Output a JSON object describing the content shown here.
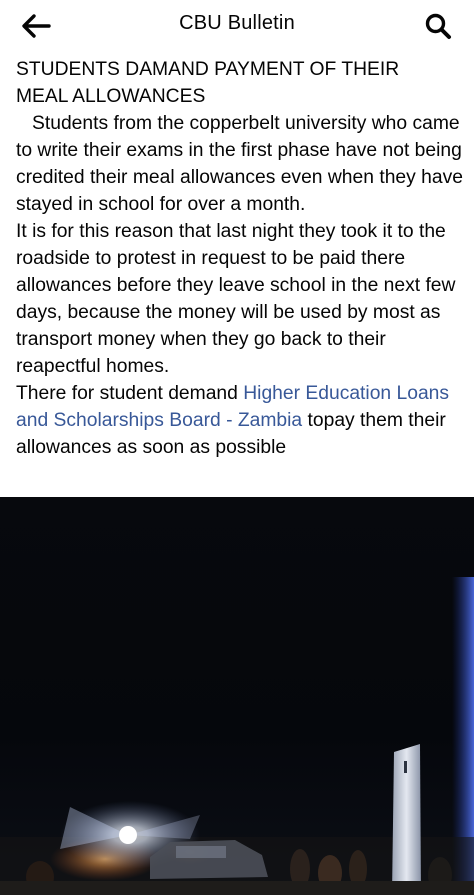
{
  "header": {
    "title": "CBU Bulletin",
    "back_icon": "back-arrow-icon",
    "search_icon": "search-icon"
  },
  "post": {
    "headline_line1": "STUDENTS DAMAND PAYMENT OF THEIR",
    "headline_line2": "MEAL ALLOWANCES",
    "para1": "Students from the copperbelt university who came to write their exams in the first phase have not being credited their meal allowances even when they have stayed in school for over a month.",
    "para2": "It is for this reason that last night they took it to the roadside to protest in request to be paid there allowances before they leave school in the next few days, because the money will be used by most as transport money when they go back to their reapectful homes.",
    "para3_before_link": "There for student demand ",
    "para3_link": "Higher Education Loans and Scholarships Board - Zambia",
    "para3_after_link": " topay them their allowances as soon as possible"
  },
  "colors": {
    "link": "#385898",
    "text": "#050505",
    "photo_background": "#050608"
  }
}
